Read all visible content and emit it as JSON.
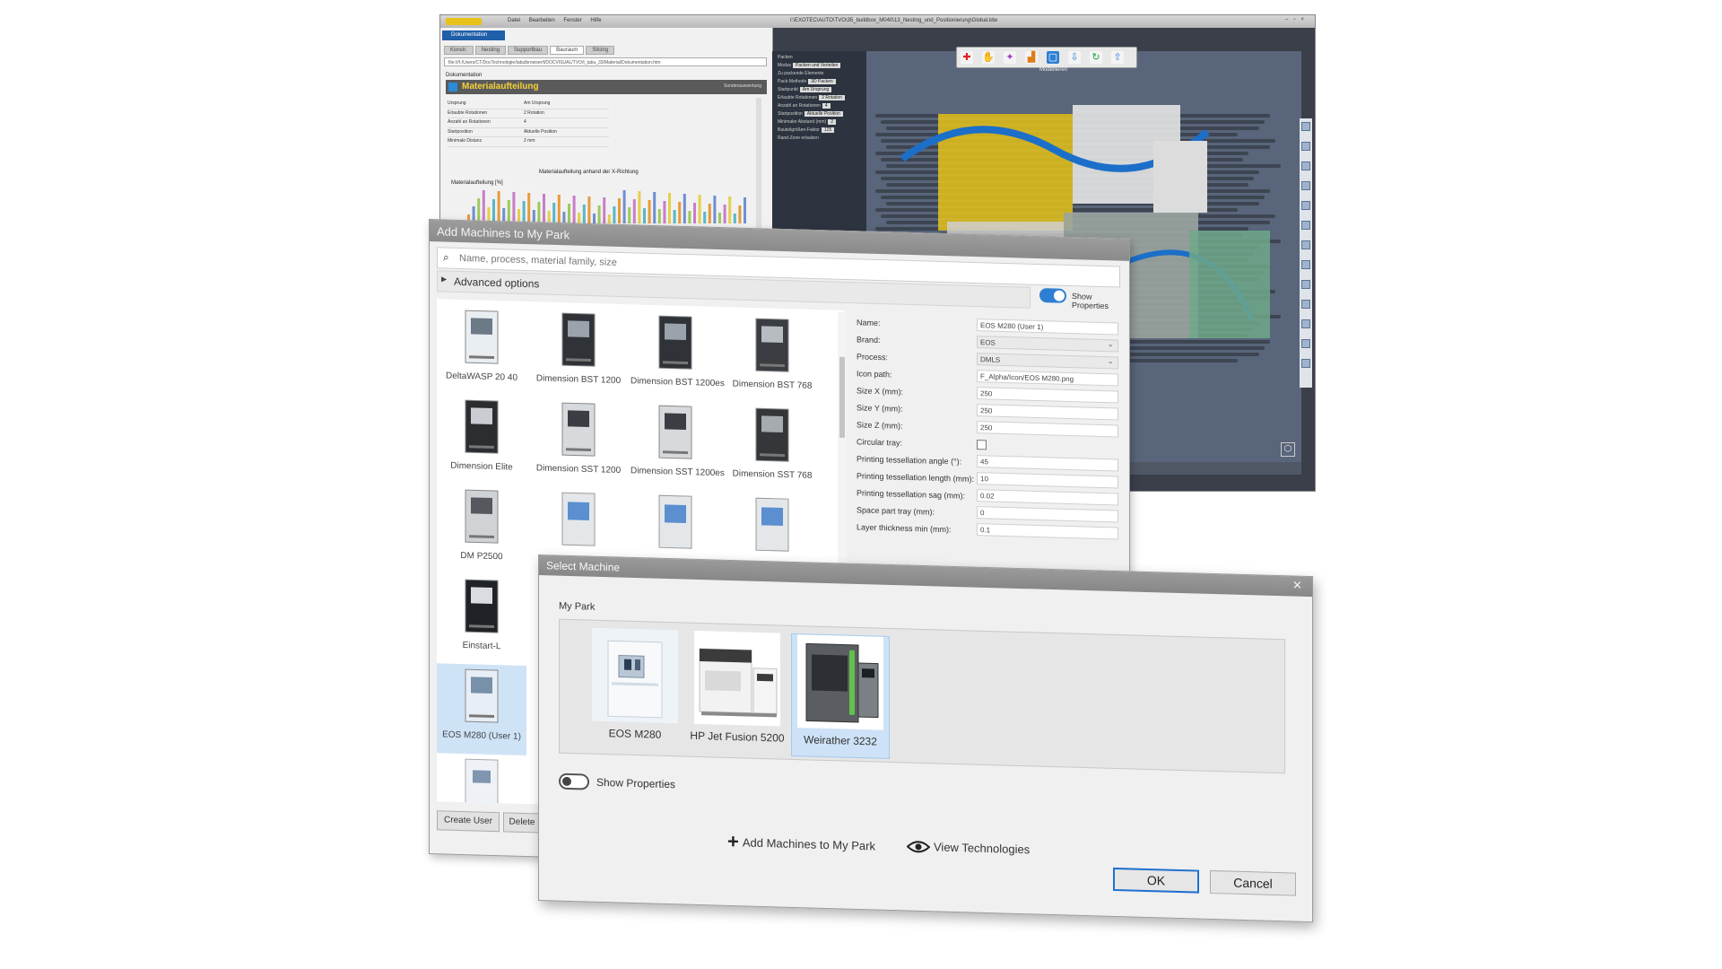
{
  "back_window": {
    "title_path": "I:\\EXOTEC\\AUTO\\TVO\\35_buildbox_M040\\13_Nesting_und_Positionierung\\Global.tdw",
    "menu": [
      "Datei",
      "Bearbeiten",
      "Fenster",
      "Hilfe"
    ],
    "doc_tab": "Dokumentation",
    "subtabs": [
      "Konstr.",
      "Nesting",
      "Supportbau",
      "Bauraum",
      "Slicing"
    ],
    "url": "file:///I:/Users/CT/DocTechnologie/tabulbrowser/t/DOCVISUAL/TVO/t_tabu_33/Material/Dokumentation.htm",
    "doc_small_heading": "Dokumentation",
    "doc_title": "Materialaufteilung",
    "doc_tag": "Sonderauswertung",
    "table": [
      {
        "k": "Ursprung",
        "v": "Am Ursprung"
      },
      {
        "k": "Erlaubte Rotationen",
        "v": "2 Rotation"
      },
      {
        "k": "Anzahl an Rotationen",
        "v": "4"
      },
      {
        "k": "Startposition",
        "v": "Aktuelle Position"
      },
      {
        "k": "Minimale Distanz",
        "v": "2 mm"
      }
    ],
    "chart_title": "Materialaufteilung anhand der X-Richtung",
    "chart_ylabel": "Materialaufteilung [%]",
    "props": [
      {
        "k": "Packen",
        "v": ""
      },
      {
        "k": "Modus",
        "v": "Packen und Verteilen"
      },
      {
        "k": "Zu packende Elemente",
        "v": ""
      },
      {
        "k": "Pack-Methode",
        "v": "3D Packen"
      },
      {
        "k": "Startpunkt",
        "v": "Am Ursprung"
      },
      {
        "k": "Erlaubte Rotationen",
        "v": "2 Rotation"
      },
      {
        "k": "Anzahl an Rotationen",
        "v": "4"
      },
      {
        "k": "Startposition",
        "v": "Aktuelle Position"
      },
      {
        "k": "Minimaler Abstand (mm)",
        "v": "2"
      },
      {
        "k": "Bauteilgrößen-Faktor",
        "v": "125"
      },
      {
        "k": "Rand-Zone erlauben",
        "v": ""
      }
    ],
    "toolbar_label": "Modellieren"
  },
  "add_machines": {
    "title": "Add Machines to My Park",
    "search_placeholder": "Name, process, material family, size",
    "advanced_options": "Advanced options",
    "show_properties": "Show Properties",
    "machines": [
      {
        "label": "DeltaWASP 20 40"
      },
      {
        "label": "Dimension BST 1200"
      },
      {
        "label": "Dimension BST 1200es"
      },
      {
        "label": "Dimension BST 768"
      },
      {
        "label": "Dimension Elite"
      },
      {
        "label": "Dimension SST 1200"
      },
      {
        "label": "Dimension SST 1200es"
      },
      {
        "label": "Dimension SST 768"
      },
      {
        "label": "DM P2500"
      },
      {
        "label": "Einstart-L"
      },
      {
        "label": "EOS M280 (User 1)"
      }
    ],
    "form": {
      "name_label": "Name:",
      "name_value": "EOS M280 (User 1)",
      "brand_label": "Brand:",
      "brand_value": "EOS",
      "process_label": "Process:",
      "process_value": "DMLS",
      "icon_label": "Icon path:",
      "icon_value": "F_Alpha/Icon/EOS M280.png",
      "sx_label": "Size X (mm):",
      "sx_value": "250",
      "sy_label": "Size Y (mm):",
      "sy_value": "250",
      "sz_label": "Size Z (mm):",
      "sz_value": "250",
      "circ_label": "Circular tray:",
      "angle_label": "Printing tessellation angle (°):",
      "angle_value": "45",
      "length_label": "Printing tessellation length (mm):",
      "length_value": "10",
      "sag_label": "Printing tessellation sag (mm):",
      "sag_value": "0.02",
      "space_label": "Space part tray (mm):",
      "space_value": "0",
      "layer_label": "Layer thickness min (mm):",
      "layer_value": "0.1"
    },
    "create_user": "Create User",
    "delete": "Delete"
  },
  "select_machine": {
    "title": "Select Machine",
    "my_park": "My Park",
    "machines": [
      {
        "label": "EOS M280"
      },
      {
        "label": "HP Jet Fusion 5200"
      },
      {
        "label": "Weirather 3232"
      }
    ],
    "show_properties": "Show Properties",
    "add_link": "Add Machines to My Park",
    "view_link": "View Technologies",
    "ok": "OK",
    "cancel": "Cancel"
  },
  "colors": {
    "accent": "#1f6fd1",
    "doc_title": "#f6d23a",
    "selection": "#cde2f6"
  }
}
